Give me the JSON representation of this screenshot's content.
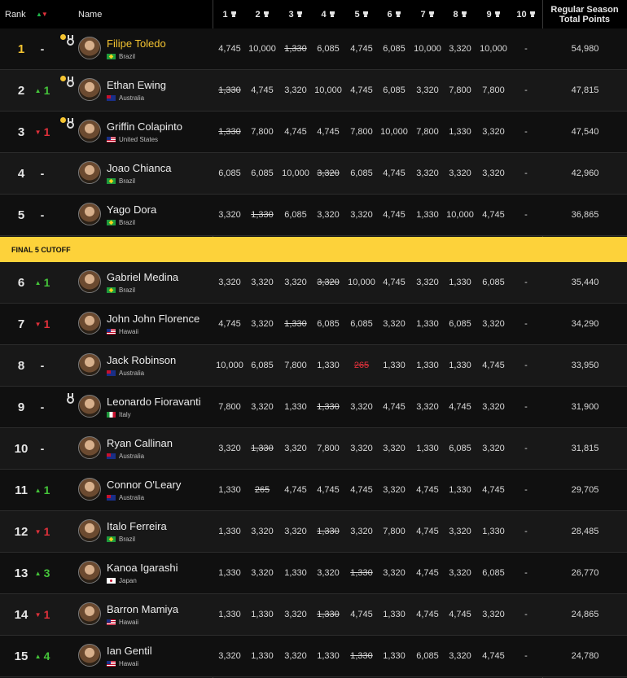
{
  "header": {
    "rank": "Rank",
    "name": "Name",
    "total": "Regular Season Total Points",
    "events": [
      "1",
      "2",
      "3",
      "4",
      "5",
      "6",
      "7",
      "8",
      "9",
      "10"
    ]
  },
  "cutoff_label": "FINAL 5 CUTOFF",
  "colors": {
    "accent_gold": "#f5c431",
    "cutoff_bg": "#fdd23a",
    "up": "#45c53a",
    "down": "#e0313b"
  },
  "rows": [
    {
      "rank": "1",
      "move": "-",
      "dir": "none",
      "name": "Filipe Toledo",
      "country": "Brazil",
      "flag": "BR",
      "highlight": true,
      "dot": true,
      "badge": true,
      "scores": [
        "4,745",
        "10,000",
        "1,330",
        "6,085",
        "4,745",
        "6,085",
        "10,000",
        "3,320",
        "10,000",
        "-"
      ],
      "dropped": [
        2
      ],
      "red": [],
      "total": "54,980"
    },
    {
      "rank": "2",
      "move": "1",
      "dir": "up",
      "name": "Ethan Ewing",
      "country": "Australia",
      "flag": "AU",
      "highlight": false,
      "dot": true,
      "badge": true,
      "scores": [
        "1,330",
        "4,745",
        "3,320",
        "10,000",
        "4,745",
        "6,085",
        "3,320",
        "7,800",
        "7,800",
        "-"
      ],
      "dropped": [
        0
      ],
      "red": [],
      "total": "47,815"
    },
    {
      "rank": "3",
      "move": "1",
      "dir": "down",
      "name": "Griffin Colapinto",
      "country": "United States",
      "flag": "US",
      "highlight": false,
      "dot": true,
      "badge": true,
      "scores": [
        "1,330",
        "7,800",
        "4,745",
        "4,745",
        "7,800",
        "10,000",
        "7,800",
        "1,330",
        "3,320",
        "-"
      ],
      "dropped": [
        0
      ],
      "red": [],
      "total": "47,540"
    },
    {
      "rank": "4",
      "move": "-",
      "dir": "none",
      "name": "Joao Chianca",
      "country": "Brazil",
      "flag": "BR",
      "highlight": false,
      "dot": false,
      "badge": false,
      "scores": [
        "6,085",
        "6,085",
        "10,000",
        "3,320",
        "6,085",
        "4,745",
        "3,320",
        "3,320",
        "3,320",
        "-"
      ],
      "dropped": [
        3
      ],
      "red": [],
      "total": "42,960"
    },
    {
      "rank": "5",
      "move": "-",
      "dir": "none",
      "name": "Yago Dora",
      "country": "Brazil",
      "flag": "BR",
      "highlight": false,
      "dot": false,
      "badge": false,
      "scores": [
        "3,320",
        "1,330",
        "6,085",
        "3,320",
        "3,320",
        "4,745",
        "1,330",
        "10,000",
        "4,745",
        "-"
      ],
      "dropped": [
        1
      ],
      "red": [],
      "total": "36,865"
    },
    {
      "rank": "6",
      "move": "1",
      "dir": "up",
      "name": "Gabriel Medina",
      "country": "Brazil",
      "flag": "BR",
      "highlight": false,
      "dot": false,
      "badge": false,
      "scores": [
        "3,320",
        "3,320",
        "3,320",
        "3,320",
        "10,000",
        "4,745",
        "3,320",
        "1,330",
        "6,085",
        "-"
      ],
      "dropped": [
        3
      ],
      "red": [],
      "total": "35,440"
    },
    {
      "rank": "7",
      "move": "1",
      "dir": "down",
      "name": "John John Florence",
      "country": "Hawaii",
      "flag": "HI",
      "highlight": false,
      "dot": false,
      "badge": false,
      "scores": [
        "4,745",
        "3,320",
        "1,330",
        "6,085",
        "6,085",
        "3,320",
        "1,330",
        "6,085",
        "3,320",
        "-"
      ],
      "dropped": [
        2
      ],
      "red": [],
      "total": "34,290"
    },
    {
      "rank": "8",
      "move": "-",
      "dir": "none",
      "name": "Jack Robinson",
      "country": "Australia",
      "flag": "AU",
      "highlight": false,
      "dot": false,
      "badge": false,
      "scores": [
        "10,000",
        "6,085",
        "7,800",
        "1,330",
        "265",
        "1,330",
        "1,330",
        "1,330",
        "4,745",
        "-"
      ],
      "dropped": [
        4
      ],
      "red": [
        4
      ],
      "total": "33,950"
    },
    {
      "rank": "9",
      "move": "-",
      "dir": "none",
      "name": "Leonardo Fioravanti",
      "country": "Italy",
      "flag": "IT",
      "highlight": false,
      "dot": false,
      "badge": true,
      "scores": [
        "7,800",
        "3,320",
        "1,330",
        "1,330",
        "3,320",
        "4,745",
        "3,320",
        "4,745",
        "3,320",
        "-"
      ],
      "dropped": [
        3
      ],
      "red": [],
      "total": "31,900"
    },
    {
      "rank": "10",
      "move": "-",
      "dir": "none",
      "name": "Ryan Callinan",
      "country": "Australia",
      "flag": "AU",
      "highlight": false,
      "dot": false,
      "badge": false,
      "scores": [
        "3,320",
        "1,330",
        "3,320",
        "7,800",
        "3,320",
        "3,320",
        "1,330",
        "6,085",
        "3,320",
        "-"
      ],
      "dropped": [
        1
      ],
      "red": [],
      "total": "31,815"
    },
    {
      "rank": "11",
      "move": "1",
      "dir": "up",
      "name": "Connor O'Leary",
      "country": "Australia",
      "flag": "AU",
      "highlight": false,
      "dot": false,
      "badge": false,
      "scores": [
        "1,330",
        "265",
        "4,745",
        "4,745",
        "4,745",
        "3,320",
        "4,745",
        "1,330",
        "4,745",
        "-"
      ],
      "dropped": [
        1
      ],
      "red": [],
      "total": "29,705"
    },
    {
      "rank": "12",
      "move": "1",
      "dir": "down",
      "name": "Italo Ferreira",
      "country": "Brazil",
      "flag": "BR",
      "highlight": false,
      "dot": false,
      "badge": false,
      "scores": [
        "1,330",
        "3,320",
        "3,320",
        "1,330",
        "3,320",
        "7,800",
        "4,745",
        "3,320",
        "1,330",
        "-"
      ],
      "dropped": [
        3
      ],
      "red": [],
      "total": "28,485"
    },
    {
      "rank": "13",
      "move": "3",
      "dir": "up",
      "name": "Kanoa Igarashi",
      "country": "Japan",
      "flag": "JP",
      "highlight": false,
      "dot": false,
      "badge": false,
      "scores": [
        "1,330",
        "3,320",
        "1,330",
        "3,320",
        "1,330",
        "3,320",
        "4,745",
        "3,320",
        "6,085",
        "-"
      ],
      "dropped": [
        4
      ],
      "red": [],
      "total": "26,770"
    },
    {
      "rank": "14",
      "move": "1",
      "dir": "down",
      "name": "Barron Mamiya",
      "country": "Hawaii",
      "flag": "HI",
      "highlight": false,
      "dot": false,
      "badge": false,
      "scores": [
        "1,330",
        "1,330",
        "3,320",
        "1,330",
        "4,745",
        "1,330",
        "4,745",
        "4,745",
        "3,320",
        "-"
      ],
      "dropped": [
        3
      ],
      "red": [],
      "total": "24,865"
    },
    {
      "rank": "15",
      "move": "4",
      "dir": "up",
      "name": "Ian Gentil",
      "country": "Hawaii",
      "flag": "HI",
      "highlight": false,
      "dot": false,
      "badge": false,
      "scores": [
        "3,320",
        "1,330",
        "3,320",
        "1,330",
        "1,330",
        "1,330",
        "6,085",
        "3,320",
        "4,745",
        "-"
      ],
      "dropped": [
        4
      ],
      "red": [],
      "total": "24,780"
    }
  ]
}
